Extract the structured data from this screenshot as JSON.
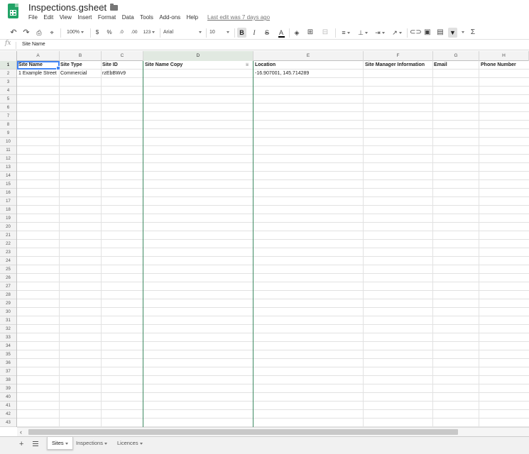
{
  "header": {
    "title": "Inspections.gsheet",
    "menus": [
      "File",
      "Edit",
      "View",
      "Insert",
      "Format",
      "Data",
      "Tools",
      "Add-ons",
      "Help"
    ],
    "last_edit": "Last edit was 7 days ago"
  },
  "toolbar": {
    "undo_icon": "undo-icon",
    "redo_icon": "redo-icon",
    "print_icon": "print-icon",
    "paint_format_icon": "paint-format-icon",
    "zoom": "100%",
    "currency": "$",
    "percent": "%",
    "decrease_decimals": ".0",
    "increase_decimals": ".00",
    "more_formats": "123",
    "font": "Arial",
    "font_size": "10",
    "bold": "B",
    "italic": "I",
    "strikethrough": "S",
    "text_color": "A",
    "sum": "Σ"
  },
  "formula_bar": {
    "fx": "fx",
    "value": "Site Name"
  },
  "grid": {
    "columns": [
      "A",
      "B",
      "C",
      "D",
      "E",
      "F",
      "G",
      "H"
    ],
    "selected_column": "D",
    "header_row": [
      "Site Name",
      "Site Type",
      "Site ID",
      "Site Name Copy",
      "Location",
      "Site Manager Information",
      "Email",
      "Phone Number"
    ],
    "data_rows": [
      [
        "1 Example Street",
        "Commercial",
        "rzEbBWv9",
        "",
        "-16.907001, 145.714289",
        "",
        "",
        ""
      ]
    ],
    "row_count": 43
  },
  "sheets": {
    "tabs": [
      "Sites",
      "Inspections",
      "Licences"
    ],
    "active": "Sites"
  },
  "colors": {
    "brand": "#21a366",
    "selection": "#4285f4",
    "selected_column_line": "#3e8a62"
  }
}
